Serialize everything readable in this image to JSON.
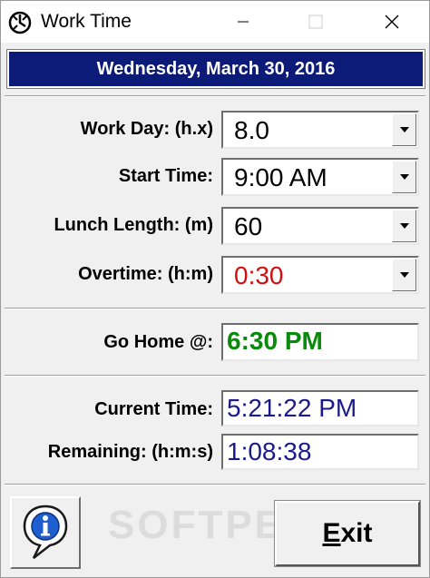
{
  "window": {
    "title": "Work Time",
    "icon": "clock-icon"
  },
  "date_banner": "Wednesday, March 30, 2016",
  "settings": [
    {
      "label": "Work Day: (h.x)",
      "value": "8.0",
      "color": "#000000"
    },
    {
      "label": "Start Time:",
      "value": "9:00 AM",
      "color": "#000000"
    },
    {
      "label": "Lunch Length: (m)",
      "value": "60",
      "color": "#000000"
    },
    {
      "label": "Overtime: (h:m)",
      "value": "0:30",
      "color": "#d01010"
    }
  ],
  "go_home": {
    "label": "Go Home @:",
    "value": "6:30 PM",
    "color": "#0a8a0a"
  },
  "current_time": {
    "label": "Current Time:",
    "value": "5:21:22 PM",
    "color": "#1a1a8c"
  },
  "remaining": {
    "label": "Remaining: (h:m:s)",
    "value": "1:08:38",
    "color": "#1a1a8c"
  },
  "buttons": {
    "info_icon": "info-icon",
    "exit_label_accel": "E",
    "exit_label_rest": "xit"
  },
  "watermark": "SOFTPEDIA",
  "colors": {
    "banner_bg": "#0c1a78",
    "window_bg": "#f0f0f0"
  }
}
